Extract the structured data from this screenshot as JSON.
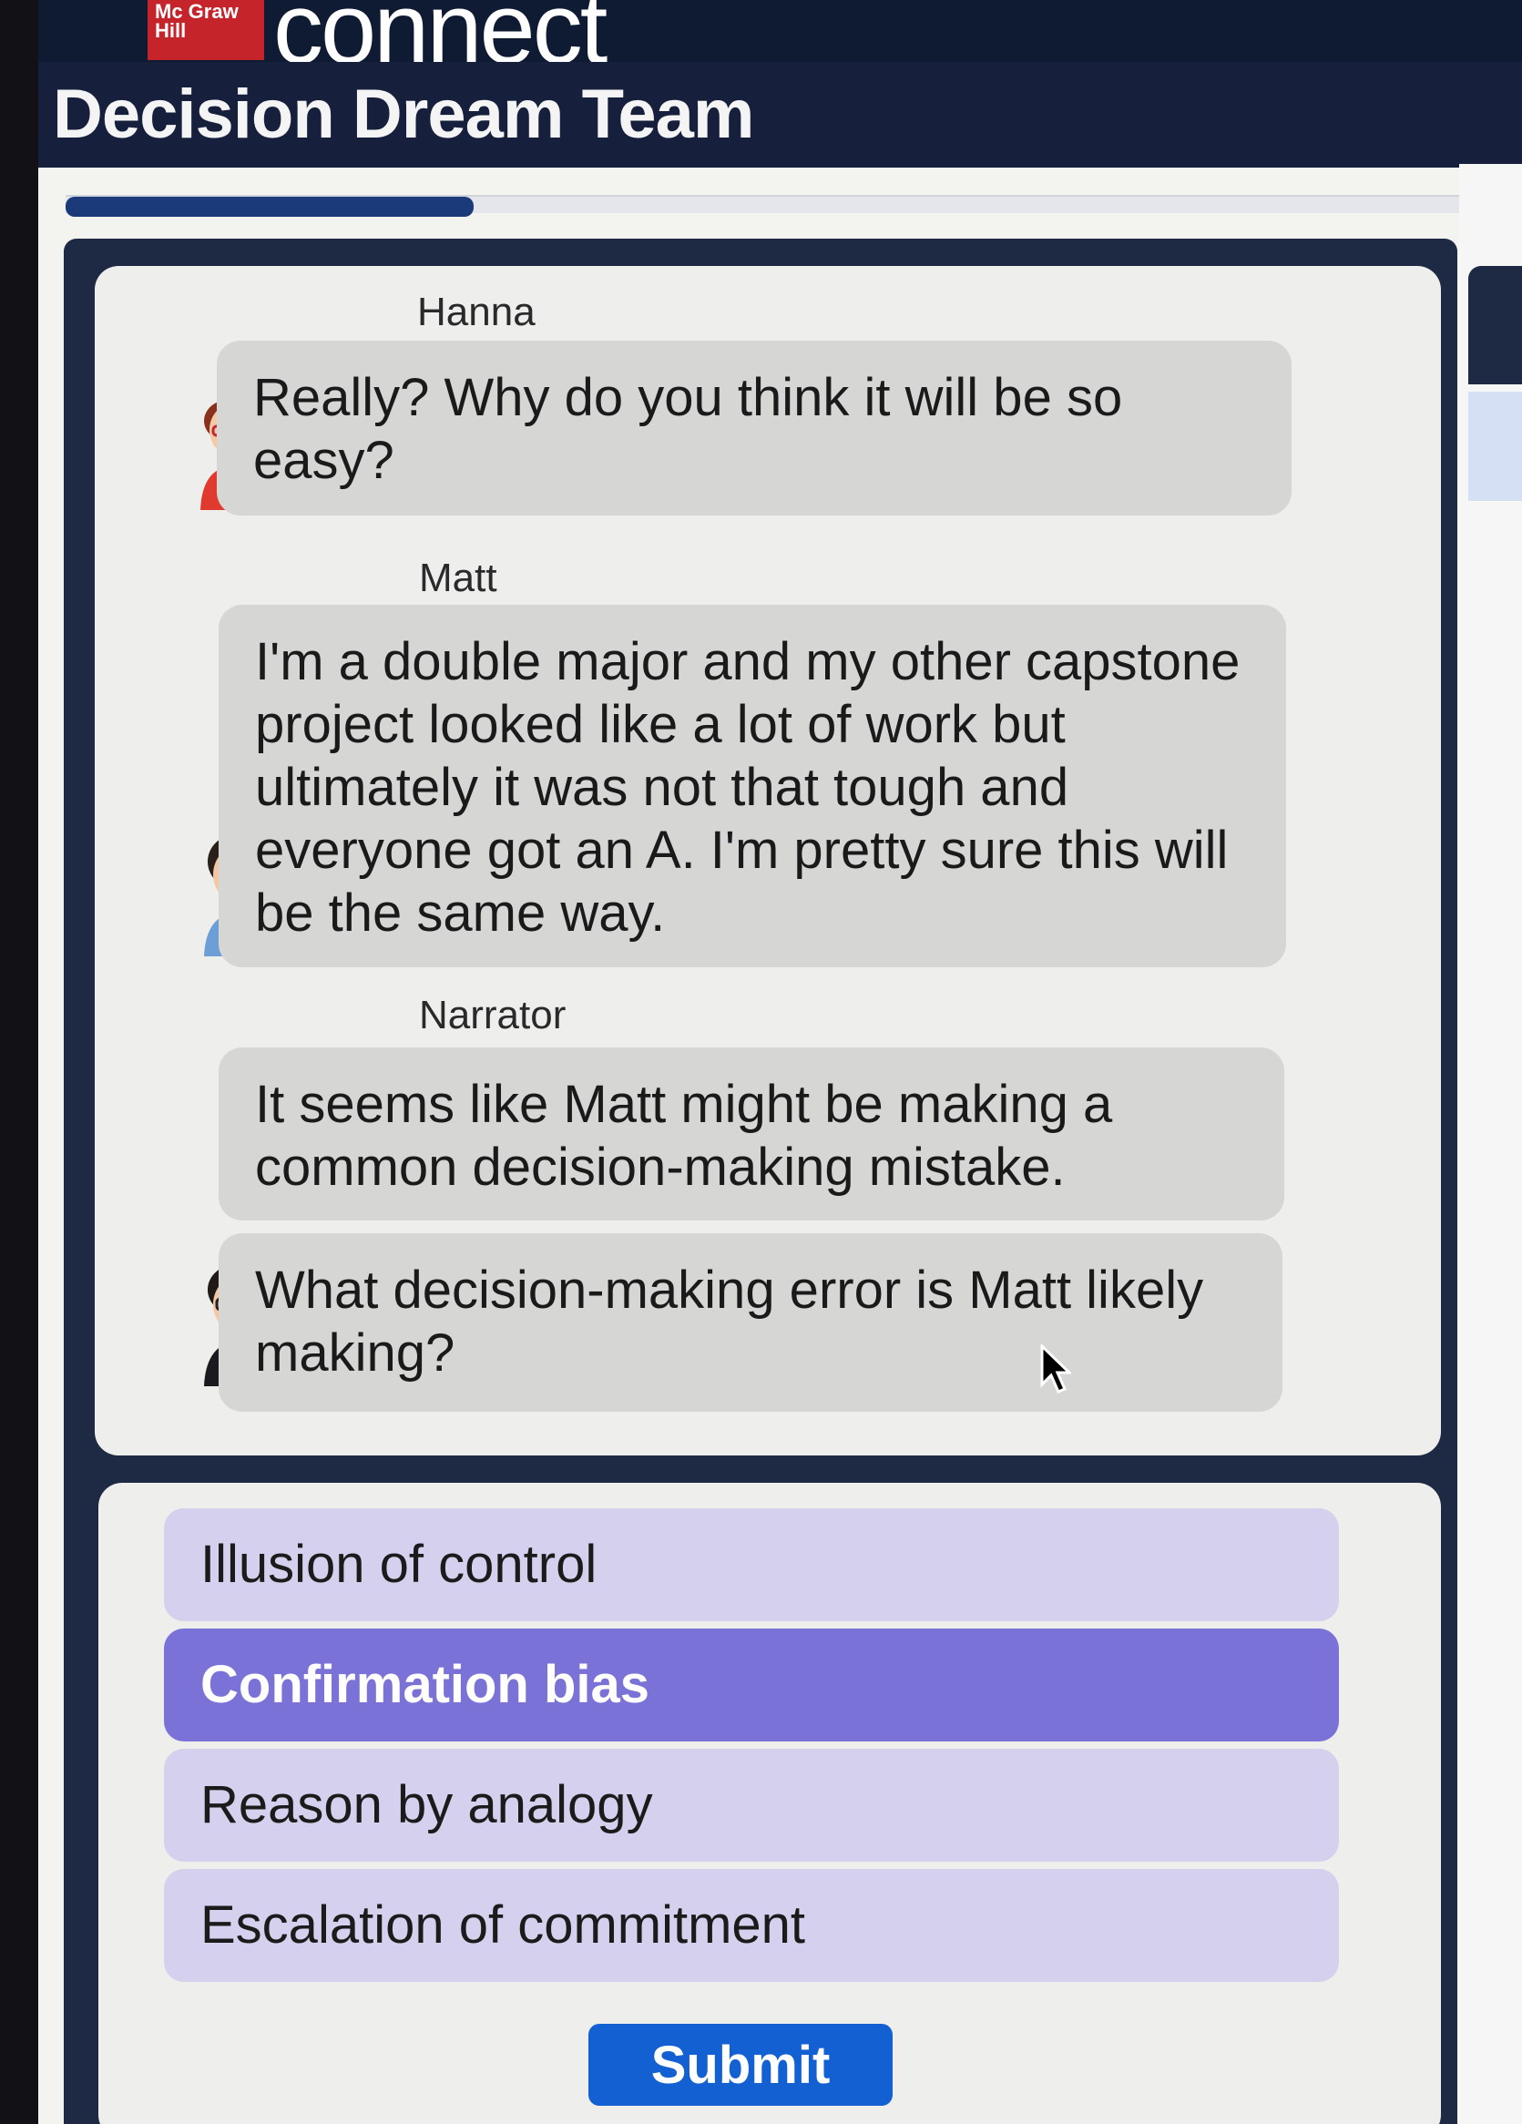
{
  "brand": {
    "logo_text": "Mc Graw Hill",
    "product": "connect"
  },
  "app": {
    "title": "Decision Dream Team"
  },
  "progress": {
    "fraction": 0.28
  },
  "conversation": [
    {
      "speaker": "Hanna",
      "text": "Really? Why do you think it will be so easy?",
      "avatar": "hanna-avatar"
    },
    {
      "speaker": "Matt",
      "text": "I'm a double major and my other capstone project looked like a lot of work but ultimately it was not that tough and everyone got an A. I'm pretty sure this will be the same way.",
      "avatar": "matt-avatar"
    },
    {
      "speaker": "Narrator",
      "text": "It seems like Matt might be making a common decision-making mistake.",
      "avatar": ""
    },
    {
      "speaker": "",
      "text": "What decision-making error is Matt likely making?",
      "avatar": "narrator-avatar"
    }
  ],
  "options": [
    {
      "label": "Illusion of control",
      "selected": false
    },
    {
      "label": "Confirmation bias",
      "selected": true
    },
    {
      "label": "Reason by analogy",
      "selected": false
    },
    {
      "label": "Escalation of commitment",
      "selected": false
    }
  ],
  "submit_label": "Submit",
  "colors": {
    "accent": "#1360d3",
    "selected_option": "#7b72d8",
    "option": "#d4d0ee",
    "header": "#16203d"
  }
}
